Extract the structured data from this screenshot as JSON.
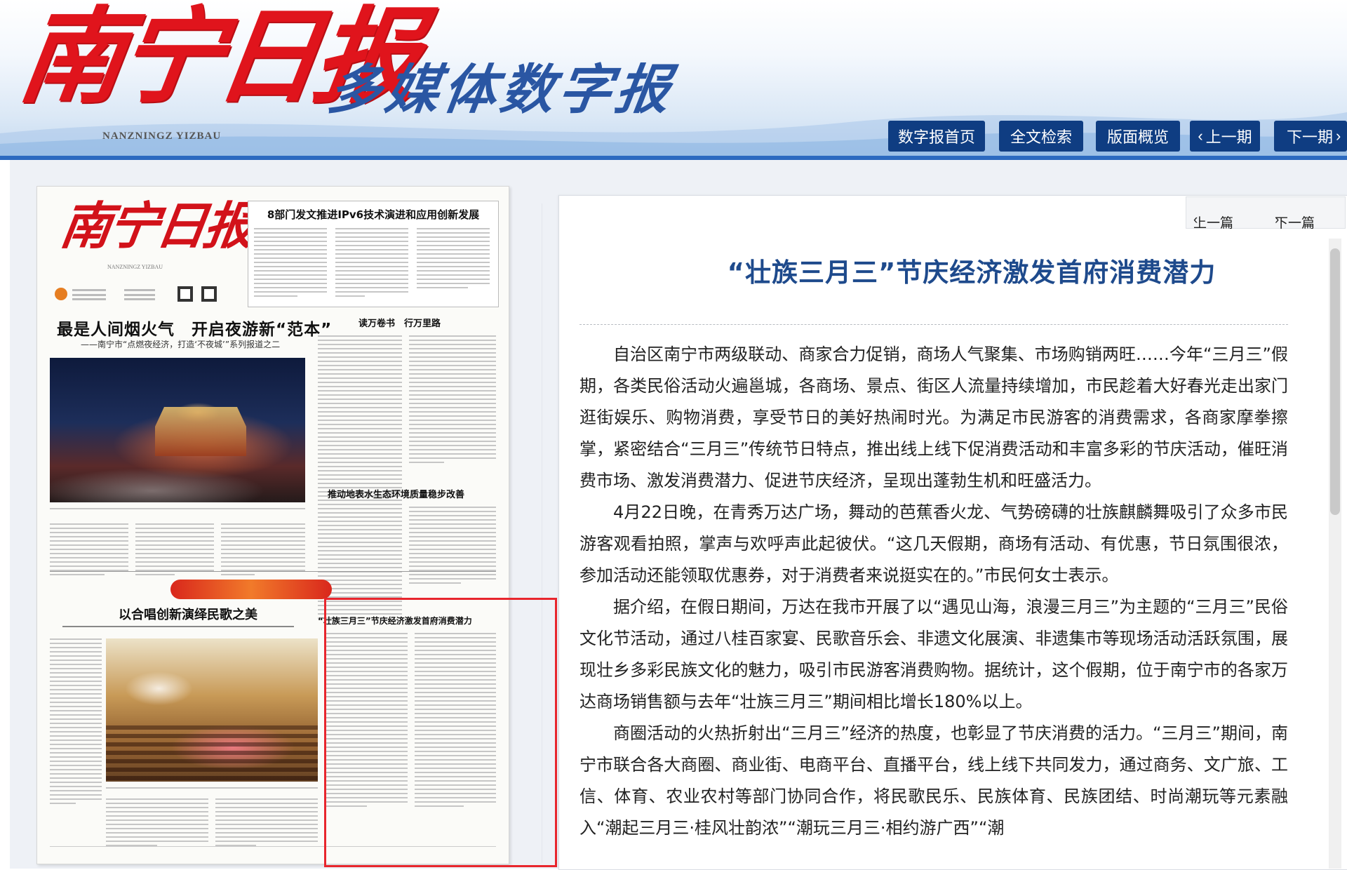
{
  "header": {
    "logo": "南宁日报",
    "logo_en": "NANZNINGZ YIZBAU",
    "subtitle": "多媒体数字报",
    "nav": [
      {
        "label": "数字报首页"
      },
      {
        "label": "全文检索"
      },
      {
        "label": "版面概览"
      },
      {
        "label": "上一期"
      },
      {
        "label": "下一期"
      }
    ]
  },
  "newspaper": {
    "masthead": "南宁日报",
    "masthead_en": "NANZNINGZ YIZBAU",
    "box_title": "8部门发文推进IPv6技术演进和应用创新发展",
    "headline": "最是人间烟火气　开启夜游新“范本”",
    "headline_sub": "——南宁市“点燃夜经济，打造‘不夜城’”系列报道之二",
    "col_title_1": "读万卷书　行万里路",
    "col_title_2": "推动地表水生态环境质量稳步改善",
    "headline_2": "以合唱创新演绎民歌之美",
    "headline_3": "“壮族三月三”节庆经济激发首府消费潜力"
  },
  "article": {
    "prev": "上一篇",
    "next": "下一篇",
    "title": "“壮族三月三”节庆经济激发首府消费潜力",
    "paragraphs": [
      "自治区南宁市两级联动、商家合力促销，商场人气聚集、市场购销两旺……今年“三月三”假期，各类民俗活动火遍邕城，各商场、景点、街区人流量持续增加，市民趁着大好春光走出家门逛街娱乐、购物消费，享受节日的美好热闹时光。为满足市民游客的消费需求，各商家摩拳擦掌，紧密结合“三月三”传统节日特点，推出线上线下促消费活动和丰富多彩的节庆活动，催旺消费市场、激发消费潜力、促进节庆经济，呈现出蓬勃生机和旺盛活力。",
      "4月22日晚，在青秀万达广场，舞动的芭蕉香火龙、气势磅礴的壮族麒麟舞吸引了众多市民游客观看拍照，掌声与欢呼声此起彼伏。“这几天假期，商场有活动、有优惠，节日氛围很浓，参加活动还能领取优惠券，对于消费者来说挺实在的。”市民何女士表示。",
      "据介绍，在假日期间，万达在我市开展了以“遇见山海，浪漫三月三”为主题的“三月三”民俗文化节活动，通过八桂百家宴、民歌音乐会、非遗文化展演、非遗集市等现场活动活跃氛围，展现壮乡多彩民族文化的魅力，吸引市民游客消费购物。据统计，这个假期，位于南宁市的各家万达商场销售额与去年“壮族三月三”期间相比增长180%以上。",
      "商圈活动的火热折射出“三月三”经济的热度，也彰显了节庆消费的活力。“三月三”期间，南宁市联合各大商圈、商业街、电商平台、直播平台，线上线下共同发力，通过商务、文广旅、工信、体育、农业农村等部门协同合作，将民歌民乐、民族体育、民族团结、时尚潮玩等元素融入“潮起三月三·桂风壮韵浓”“潮玩三月三·相约游广西”“潮"
    ]
  }
}
